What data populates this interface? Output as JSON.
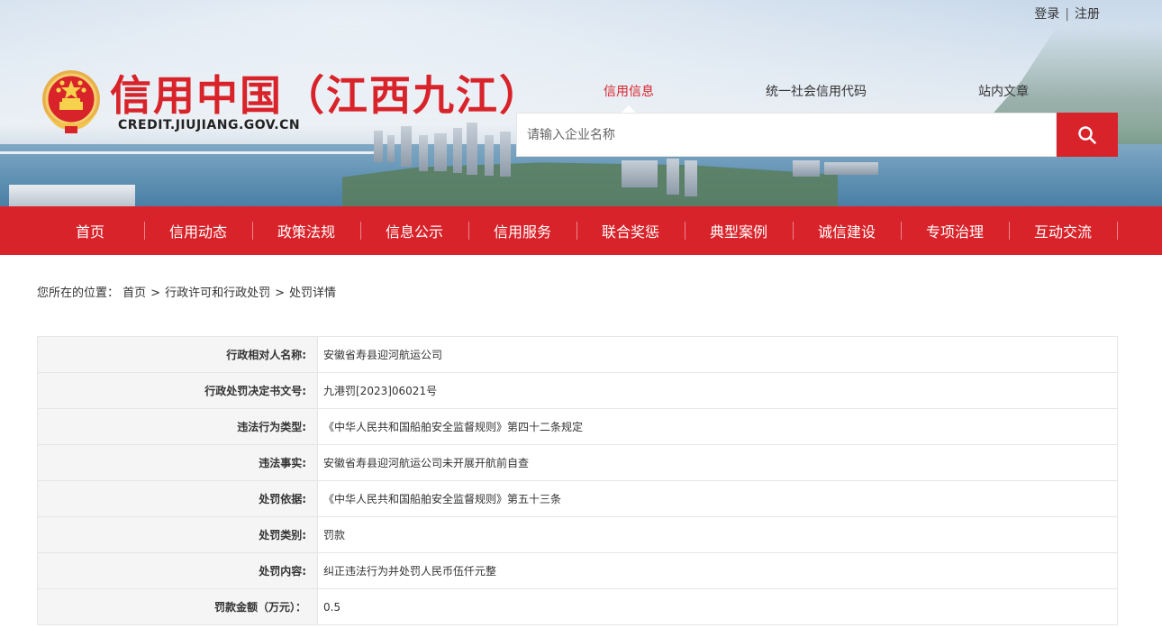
{
  "header": {
    "login_label": "登录",
    "separator": "|",
    "register_label": "注册",
    "site_title": "信用中国（江西九江）",
    "site_domain": "CREDIT.JIUJIANG.GOV.CN",
    "emblem_icon": "national-emblem-icon"
  },
  "search": {
    "tabs": [
      "信用信息",
      "统一社会信用代码",
      "站内文章"
    ],
    "active_tab": "信用信息",
    "placeholder": "请输入企业名称",
    "value": "",
    "button_icon": "search-icon"
  },
  "nav": {
    "items": [
      "首页",
      "信用动态",
      "政策法规",
      "信息公示",
      "信用服务",
      "联合奖惩",
      "典型案例",
      "诚信建设",
      "专项治理",
      "互动交流"
    ]
  },
  "breadcrumb": {
    "prefix": "您所在的位置：",
    "items": [
      "首页",
      "行政许可和行政处罚",
      "处罚详情"
    ],
    "separator": ">"
  },
  "detail": {
    "rows": [
      {
        "label": "行政相对人名称:",
        "value": "安徽省寿县迎河航运公司"
      },
      {
        "label": "行政处罚决定书文号:",
        "value": "九港罚[2023]06021号"
      },
      {
        "label": "违法行为类型:",
        "value": "《中华人民共和国船舶安全监督规则》第四十二条规定"
      },
      {
        "label": "违法事实:",
        "value": "安徽省寿县迎河航运公司未开展开航前自查"
      },
      {
        "label": "处罚依据:",
        "value": "《中华人民共和国船舶安全监督规则》第五十三条"
      },
      {
        "label": "处罚类别:",
        "value": "罚款"
      },
      {
        "label": "处罚内容:",
        "value": "纠正违法行为并处罚人民币伍仟元整"
      },
      {
        "label": "罚款金额（万元）：",
        "value": "0.5"
      }
    ]
  },
  "colors": {
    "brand_red": "#d9232a"
  }
}
